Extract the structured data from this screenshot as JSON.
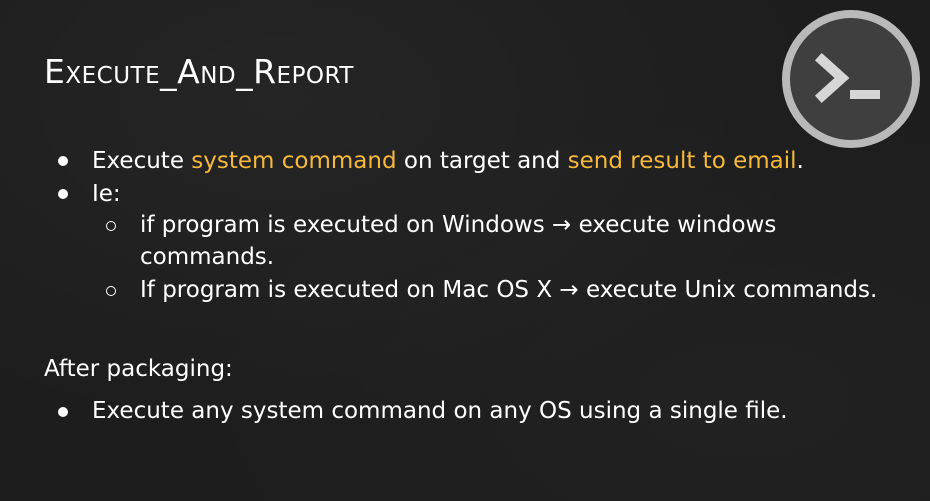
{
  "slide": {
    "title": "Execute_And_Report",
    "icon": "terminal-icon",
    "accent_color": "#f6b93b",
    "bullet1": {
      "t1": "Execute ",
      "h1": "system command",
      "t2": " on target and ",
      "h2": "send result to email",
      "t3": "."
    },
    "bullet2": "Ie:",
    "sub1_line1": "if program is executed on Windows → execute windows",
    "sub1_line2": "commands.",
    "sub2": "If program is executed on Mac OS X → execute Unix commands.",
    "after_heading": "After packaging:",
    "bullet3": "Execute any system command on any OS using a single file."
  }
}
